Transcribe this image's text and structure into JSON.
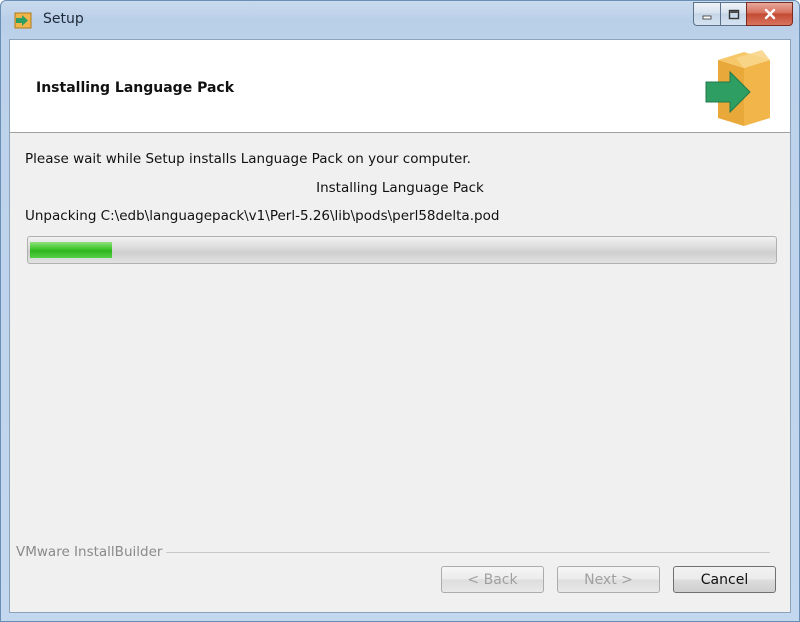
{
  "window": {
    "title": "Setup"
  },
  "header": {
    "title": "Installing Language Pack"
  },
  "body": {
    "wait_message": "Please wait while Setup installs Language Pack on your computer.",
    "status_line": "Installing Language Pack",
    "unpacking_line": "Unpacking C:\\edb\\languagepack\\v1\\Perl-5.26\\lib\\pods\\perl58delta.pod",
    "progress_fraction": 0.11
  },
  "footer": {
    "brand_label": "VMware InstallBuilder",
    "back_label": "< Back",
    "next_label": "Next >",
    "cancel_label": "Cancel"
  },
  "colors": {
    "progress_fill": "#3cc52a",
    "logo_box": "#f1b54a",
    "logo_arrow": "#2f9e63"
  },
  "icons": [
    "setup-app-icon",
    "minimize-icon",
    "maximize-icon",
    "close-icon",
    "installer-box-arrow-icon"
  ]
}
